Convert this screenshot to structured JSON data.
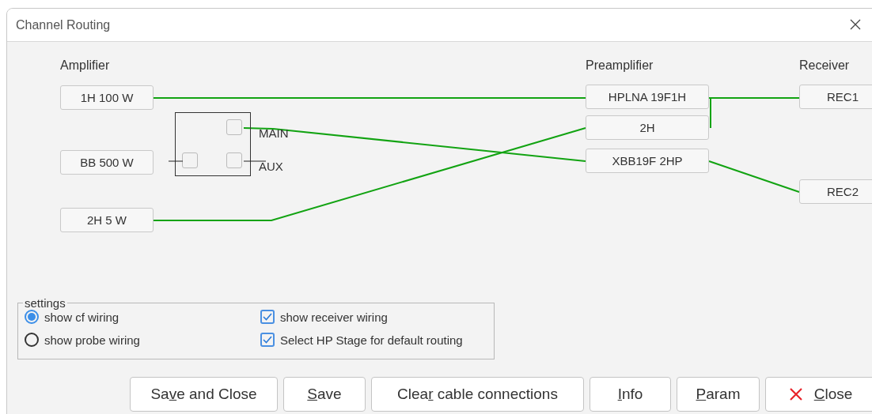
{
  "window": {
    "title": "Channel Routing"
  },
  "columns": [
    {
      "heading": "Amplifier",
      "nodes": [
        "1H 100 W",
        "BB 500 W",
        "2H 5 W"
      ]
    },
    {
      "heading": "Preamplifier",
      "nodes": [
        "HPLNA 19F1H",
        "2H",
        "XBB19F 2HP"
      ]
    },
    {
      "heading": "Receiver",
      "nodes": [
        "REC1",
        "REC2"
      ]
    }
  ],
  "switch": {
    "ports": [
      "MAIN",
      "AUX"
    ]
  },
  "settings": {
    "title": "settings",
    "options": [
      {
        "kind": "radio",
        "label": "show cf wiring",
        "selected": true
      },
      {
        "kind": "checkbox",
        "label": "show receiver wiring",
        "checked": true
      },
      {
        "kind": "radio",
        "label": "show probe wiring",
        "selected": false
      },
      {
        "kind": "checkbox",
        "label": "Select HP Stage for default routing",
        "checked": true
      }
    ]
  },
  "buttons": [
    {
      "pre": "Sa",
      "key": "v",
      "post": "e and Close"
    },
    {
      "key": "S",
      "post": "ave"
    },
    {
      "pre": "Clea",
      "key": "r",
      "post": " cable connections"
    },
    {
      "key": "I",
      "post": "nfo"
    },
    {
      "key": "P",
      "post": "aram"
    },
    {
      "key": "C",
      "post": "lose",
      "kind": "close"
    }
  ]
}
